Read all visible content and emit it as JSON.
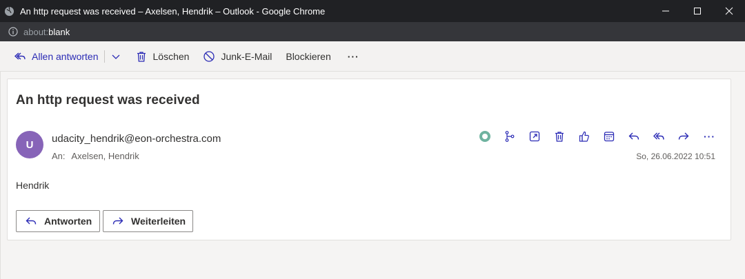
{
  "window": {
    "title": "An http request was received – Axelsen, Hendrik – Outlook - Google Chrome",
    "url_scheme": "about:",
    "url_path": "blank"
  },
  "toolbar": {
    "reply_all_label": "Allen antworten",
    "delete_label": "Löschen",
    "junk_label": "Junk-E-Mail",
    "block_label": "Blockieren",
    "more_label": "···"
  },
  "message": {
    "subject": "An http request was received",
    "avatar_initial": "U",
    "avatar_color": "#8764b8",
    "sender": "udacity_hendrik@eon-orchestra.com",
    "to_label": "An:",
    "recipient": "Axelsen, Hendrik",
    "date": "So, 26.06.2022 10:51",
    "body": "Hendrik",
    "reply_button": "Antworten",
    "forward_button": "Weiterleiten",
    "more_label": "···"
  },
  "colors": {
    "accent": "#2b2bb5",
    "presence": "#6fb3a0"
  }
}
